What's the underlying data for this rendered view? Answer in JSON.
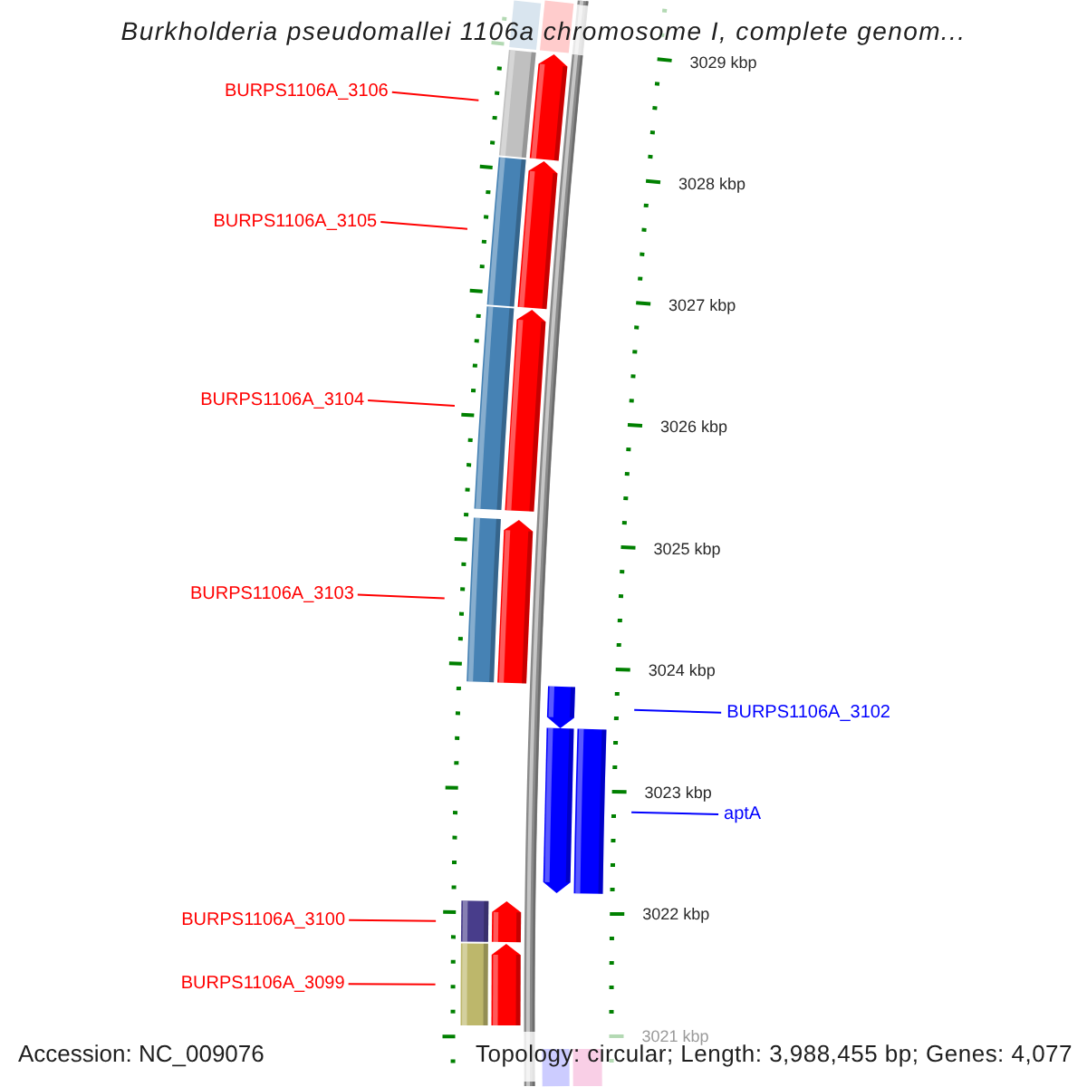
{
  "title": "Burkholderia pseudomallei 1106a chromosome I, complete genom...",
  "features": [
    {
      "kind": "forward",
      "color": "#d9e5ef"
    },
    {
      "kind": "forward",
      "label": "BURPS1106A_3106",
      "color": "#c0c0c0"
    },
    {
      "kind": "forward",
      "label": "BURPS1106A_3105",
      "color": "#4682b4"
    },
    {
      "kind": "forward",
      "label": "BURPS1106A_3104",
      "color": "#4682b4"
    },
    {
      "kind": "forward",
      "label": "BURPS1106A_3103",
      "color": "#4682b4"
    },
    {
      "kind": "reverse",
      "label": "BURPS1106A_3102"
    },
    {
      "kind": "reverse",
      "label": "aptA",
      "color": "#0000ff"
    },
    {
      "kind": "forward",
      "label": "BURPS1106A_3100",
      "color": "#483d8b"
    },
    {
      "kind": "forward",
      "label": "BURPS1106A_3099",
      "color": "#bdb76b"
    },
    {
      "kind": "reverse",
      "color": "#f9cfe6"
    }
  ],
  "scale_labels": [
    "3029 kbp",
    "3028 kbp",
    "3027 kbp",
    "3026 kbp",
    "3025 kbp",
    "3024 kbp",
    "3023 kbp",
    "3022 kbp",
    "3021 kbp"
  ],
  "footer": {
    "accession": "Accession: NC_009076",
    "summary": "Topology: circular; Length: 3,988,455 bp; Genes: 4,077"
  }
}
